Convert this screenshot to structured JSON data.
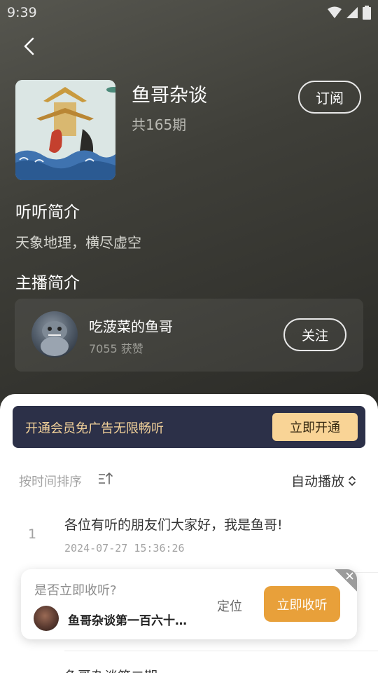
{
  "status_bar": {
    "time": "9:39"
  },
  "album": {
    "title": "鱼哥杂谈",
    "episode_count": "共165期",
    "subscribe_label": "订阅"
  },
  "intro": {
    "heading": "听听简介",
    "text": "天象地理，横尽虚空"
  },
  "host": {
    "heading": "主播简介",
    "name": "吃菠菜的鱼哥",
    "likes": "7055 获赞",
    "follow_label": "关注"
  },
  "vip": {
    "text": "开通会员免广告无限畅听",
    "button_label": "立即开通"
  },
  "list_controls": {
    "sort_label": "按时间排序",
    "autoplay_label": "自动播放"
  },
  "episodes": [
    {
      "index": "1",
      "title": "各位有听的朋友们大家好，我是鱼哥!",
      "date": "2024-07-27 15:36:26"
    },
    {
      "title": "鱼哥杂谈第二期"
    }
  ],
  "popup": {
    "question": "是否立即收听?",
    "episode_title": "鱼哥杂谈第一百六十…",
    "locate_label": "定位",
    "play_label": "立即收听"
  },
  "colors": {
    "accent_orange": "#e8a03a",
    "vip_gold": "#f9d496",
    "vip_bg": "#2c3048"
  }
}
